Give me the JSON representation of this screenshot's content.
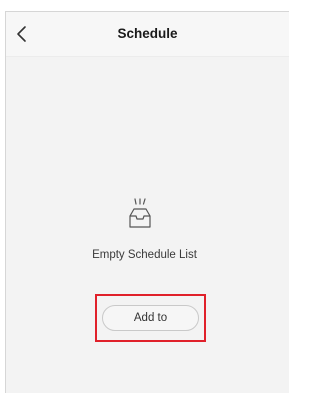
{
  "header": {
    "title": "Schedule",
    "back_icon": "chevron-left-icon"
  },
  "empty_state": {
    "icon": "empty-tray-icon",
    "message": "Empty Schedule List"
  },
  "actions": {
    "add_label": "Add to"
  },
  "colors": {
    "highlight": "#e0202a",
    "background": "#f3f3f3",
    "header_background": "#f7f7f7"
  }
}
